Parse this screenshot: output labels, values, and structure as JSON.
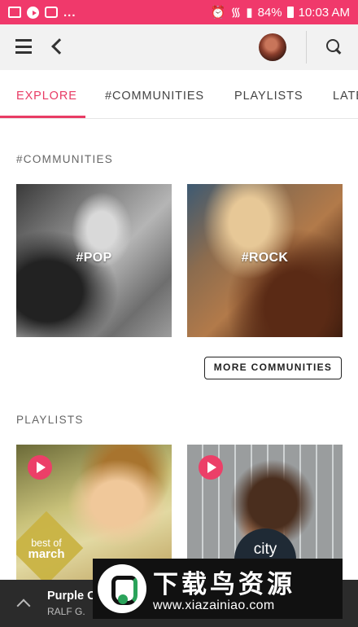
{
  "status_bar": {
    "battery": "84%",
    "time": "10:03 AM",
    "left_dots": "...",
    "left_icons": [
      "image-icon",
      "play-circle-icon",
      "chat-icon"
    ],
    "right_icons": [
      "alarm-icon",
      "wifi-icon",
      "signal-icon",
      "battery-icon"
    ],
    "color": "#f0396b"
  },
  "toolbar": {
    "icons": [
      "menu-icon",
      "back-arrow-icon",
      "avatar",
      "search-icon"
    ]
  },
  "tabs": [
    {
      "label": "EXPLORE",
      "active": true
    },
    {
      "label": "#COMMUNITIES",
      "active": false
    },
    {
      "label": "PLAYLISTS",
      "active": false
    },
    {
      "label": "LATE",
      "active": false
    }
  ],
  "communities": {
    "heading": "#COMMUNITIES",
    "tiles": [
      {
        "label": "#POP"
      },
      {
        "label": "#ROCK"
      }
    ],
    "more_button": "MORE COMMUNITIES"
  },
  "playlists": {
    "heading": "PLAYLISTS",
    "tiles": [
      {
        "badge_line1": "best of",
        "badge_line2": "march",
        "play_icon": "play-icon"
      },
      {
        "badge": "city",
        "play_icon": "play-icon"
      }
    ]
  },
  "player": {
    "title": "Purple C",
    "artist": "RALF G."
  },
  "watermark": {
    "name": "下载鸟资源",
    "url": "www.xiazainiao.com"
  },
  "colors": {
    "accent": "#e83b64",
    "status_bar": "#f0396b",
    "player_bg": "#2b2b2b"
  }
}
